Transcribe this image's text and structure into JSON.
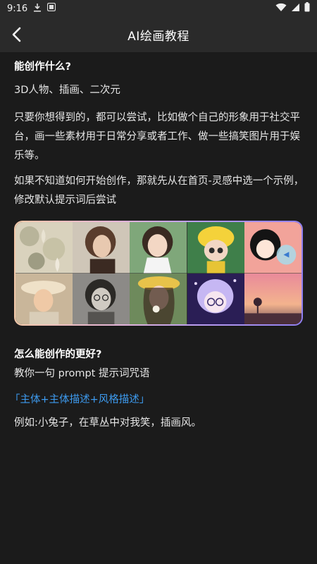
{
  "status_bar": {
    "time": "9:16",
    "icons": [
      "download-icon",
      "notification-app-icon",
      "wifi-icon",
      "signal-icon",
      "battery-icon"
    ]
  },
  "app_bar": {
    "title": "AI绘画教程",
    "back_icon": "chevron-left-icon"
  },
  "sections": {
    "what_title": "能创作什么?",
    "what_types": "3D人物、插画、二次元",
    "what_desc": "只要你想得到的，都可以尝试，比如做个自己的形象用于社交平台，画一些素材用于日常分享或者工作、做一些搞笑图片用于娱乐等。",
    "how_start": "如果不知道如何开始创作，那就先从在首页-灵感中选一个示例，修改默认提示词后尝试",
    "better_title": "怎么能创作的更好?",
    "prompt_intro": "教你一句 prompt 提示词咒语",
    "formula": "「主体+主体描述+风格描述」",
    "example": "例如:小兔子，在草丛中对我笑，插画风。"
  },
  "gallery": {
    "tiles": [
      "lotus-painting",
      "vintage-portrait-girl",
      "anime-girl-braids",
      "3d-chibi-yellow-hat",
      "anime-girl-fishbowl",
      "girl-sunhat-painting",
      "old-photo-glasses-woman",
      "girl-with-flower-hat",
      "purple-chibi-glasses",
      "sunset-landscape"
    ]
  },
  "colors": {
    "background": "#1b1b1b",
    "app_bar": "#2a2a2a",
    "accent_link": "#3d9bf0"
  }
}
